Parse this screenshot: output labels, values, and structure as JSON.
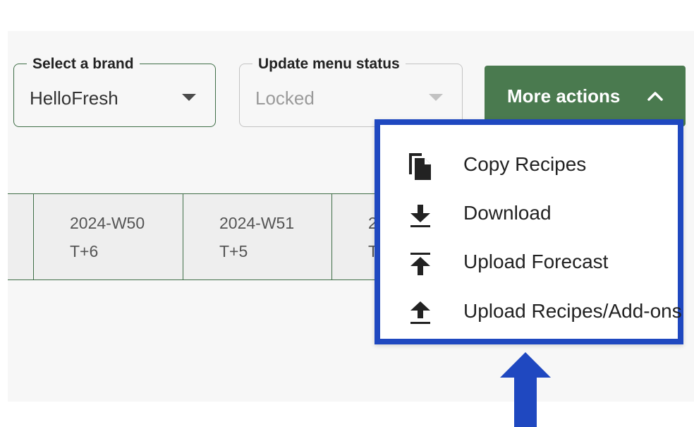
{
  "filters": {
    "brand": {
      "legend": "Select a brand",
      "value": "HelloFresh"
    },
    "status": {
      "legend": "Update menu status",
      "value": "Locked"
    }
  },
  "more_actions": {
    "label": "More actions"
  },
  "weeks": [
    {
      "week": "2024-W50",
      "offset": "T+6"
    },
    {
      "week": "2024-W51",
      "offset": "T+5"
    },
    {
      "week": "2",
      "offset": "T"
    }
  ],
  "menu": {
    "items": [
      {
        "label": "Copy Recipes",
        "icon": "copy-icon"
      },
      {
        "label": "Download",
        "icon": "download-icon"
      },
      {
        "label": "Upload Forecast",
        "icon": "upload-icon"
      },
      {
        "label": "Upload Recipes/Add-ons",
        "icon": "upload-icon"
      }
    ]
  },
  "colors": {
    "accent": "#4a7a4f",
    "highlight": "#1f48c0"
  }
}
